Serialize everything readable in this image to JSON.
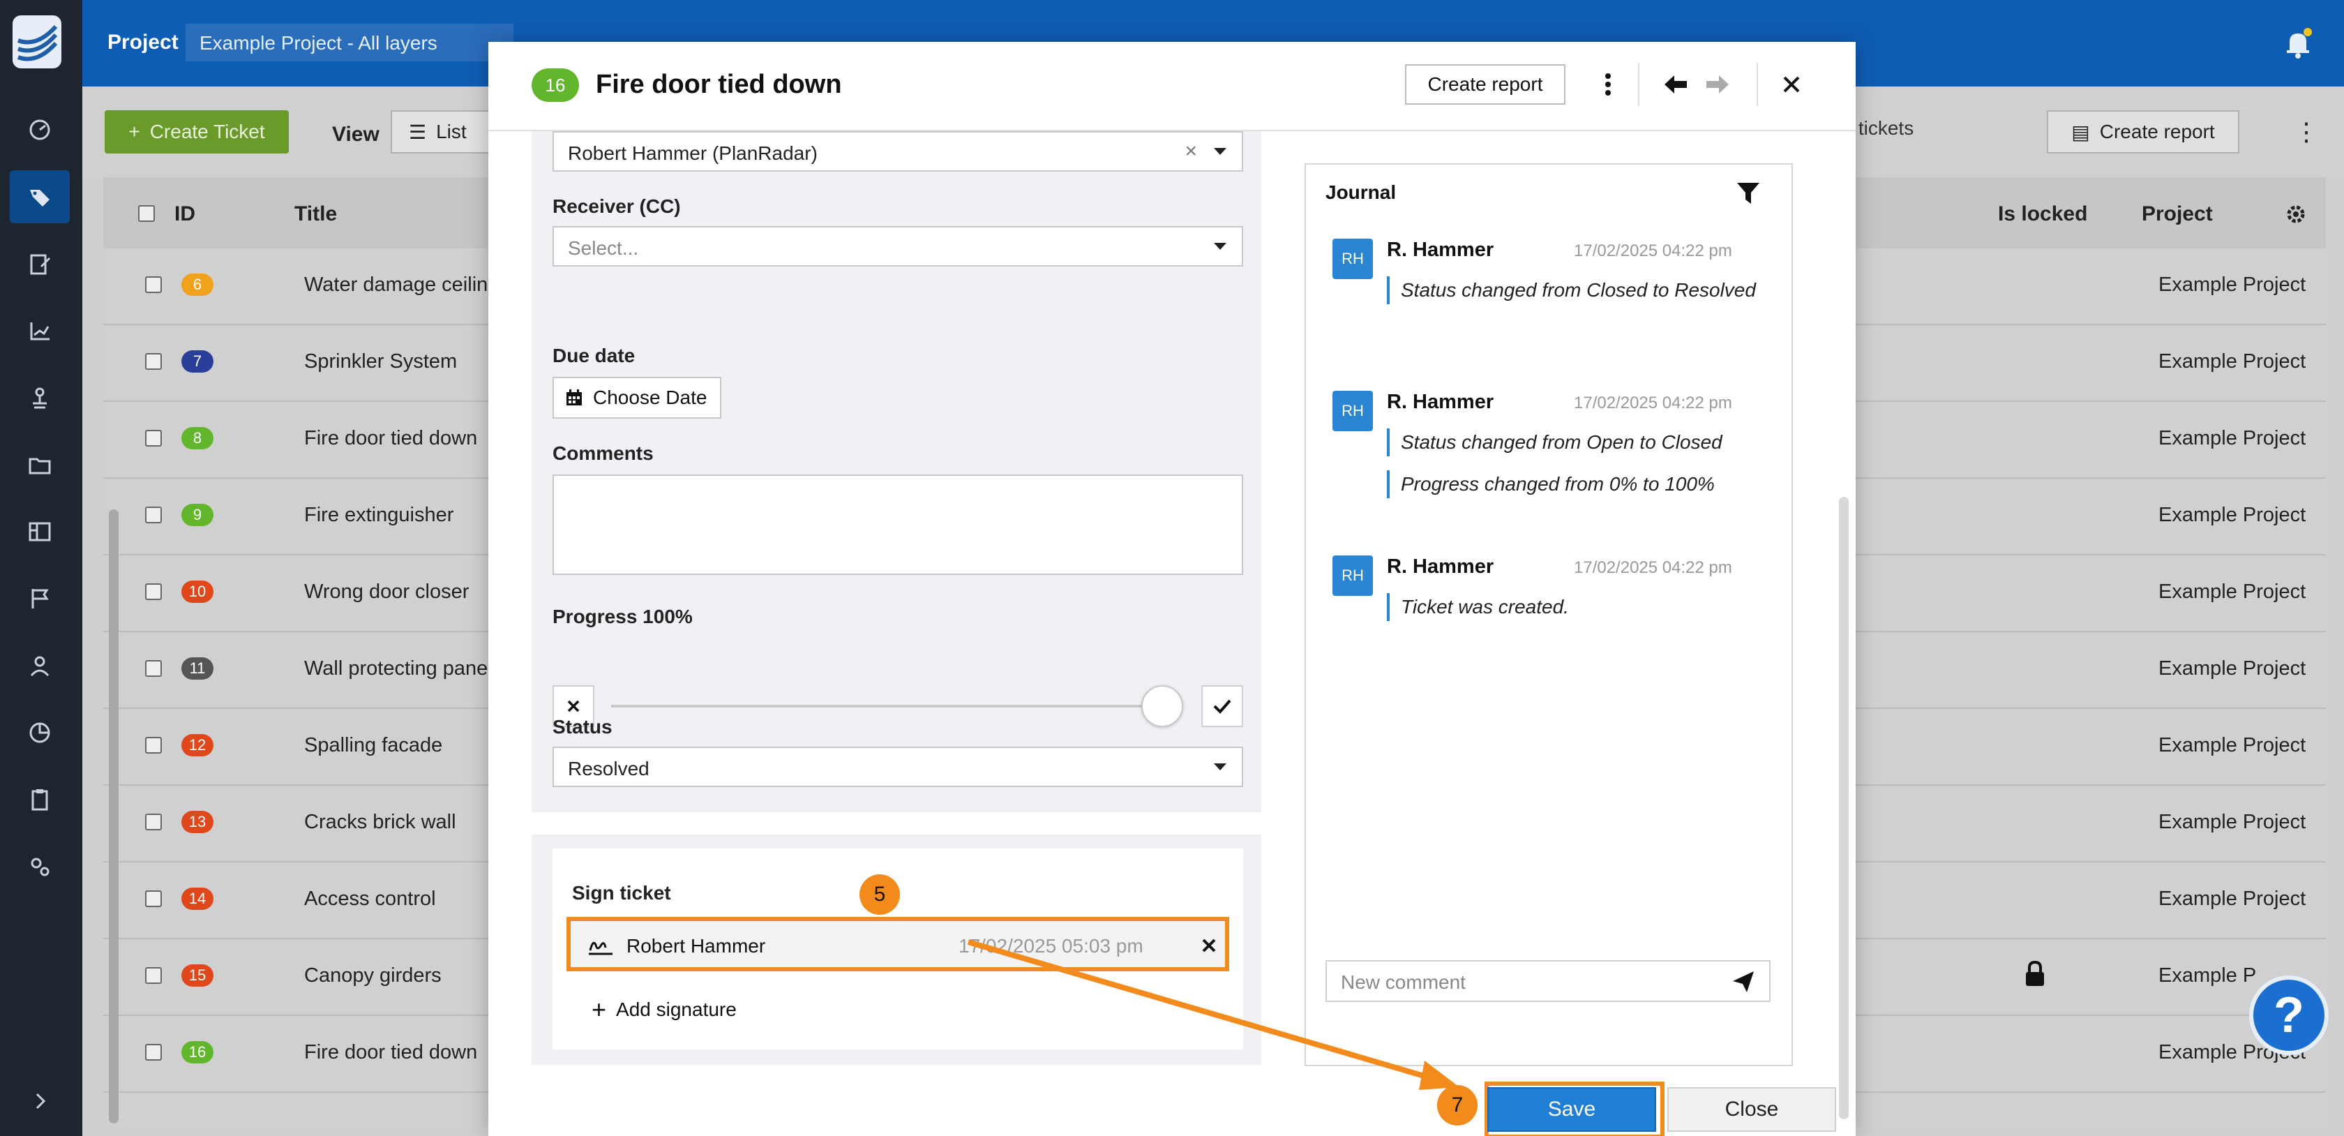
{
  "topbar": {
    "project_label": "Project",
    "project_value": "Example Project - All layers"
  },
  "toolbar": {
    "create_ticket": "Create Ticket",
    "view_label": "View",
    "list_label": "List",
    "hide_closed": "ide closed tickets",
    "create_report": "Create report"
  },
  "table": {
    "headers": {
      "id": "ID",
      "title": "Title",
      "is_locked": "Is locked",
      "project": "Project"
    },
    "rows": [
      {
        "id": "6",
        "title": "Water damage ceiling",
        "project": "Example Project",
        "color": "#f0a21c",
        "locked": false
      },
      {
        "id": "7",
        "title": "Sprinkler System",
        "project": "Example Project",
        "color": "#2a3f9a",
        "locked": false
      },
      {
        "id": "8",
        "title": "Fire door tied down",
        "project": "Example Project",
        "color": "#62b62c",
        "locked": false
      },
      {
        "id": "9",
        "title": "Fire extinguisher",
        "project": "Example Project",
        "color": "#62b62c",
        "locked": false
      },
      {
        "id": "10",
        "title": "Wrong door closer",
        "project": "Example Project",
        "color": "#e0481c",
        "locked": false
      },
      {
        "id": "11",
        "title": "Wall protecting panel",
        "project": "Example Project",
        "color": "#555555",
        "locked": false
      },
      {
        "id": "12",
        "title": "Spalling facade",
        "project": "Example Project",
        "color": "#e0481c",
        "locked": false
      },
      {
        "id": "13",
        "title": "Cracks brick wall",
        "project": "Example Project",
        "color": "#e0481c",
        "locked": false
      },
      {
        "id": "14",
        "title": "Access control",
        "project": "Example Project",
        "color": "#e0481c",
        "locked": false
      },
      {
        "id": "15",
        "title": "Canopy girders",
        "project": "Example P",
        "color": "#e0481c",
        "locked": true
      },
      {
        "id": "16",
        "title": "Fire door tied down",
        "project": "Example Project",
        "color": "#62b62c",
        "locked": false
      }
    ]
  },
  "modal": {
    "badge": "16",
    "title": "Fire door tied down",
    "create_report": "Create report",
    "assignee_value": "Robert Hammer (PlanRadar)",
    "receiver_label": "Receiver (CC)",
    "receiver_placeholder": "Select...",
    "due_date_label": "Due date",
    "choose_date": "Choose Date",
    "comments_label": "Comments",
    "progress_label": "Progress 100%",
    "progress_value": 1.0,
    "status_label": "Status",
    "status_value": "Resolved",
    "sign_ticket_label": "Sign ticket",
    "signature_name": "Robert Hammer",
    "signature_date": "17/02/2025 05:03 pm",
    "add_signature": "Add signature",
    "save": "Save",
    "close": "Close"
  },
  "journal": {
    "title": "Journal",
    "entries": [
      {
        "initials": "RH",
        "name": "R. Hammer",
        "time": "17/02/2025 04:22 pm",
        "lines": [
          "Status changed from Closed to Resolved"
        ]
      },
      {
        "initials": "RH",
        "name": "R. Hammer",
        "time": "17/02/2025 04:22 pm",
        "lines": [
          "Status changed from Open to Closed",
          "Progress changed from 0% to 100%"
        ]
      },
      {
        "initials": "RH",
        "name": "R. Hammer",
        "time": "17/02/2025 04:22 pm",
        "lines": [
          "Ticket was created."
        ]
      }
    ],
    "comment_placeholder": "New comment"
  },
  "callouts": {
    "step5": "5",
    "step7": "7"
  },
  "help": "?",
  "colors": {
    "primary": "#1f7fd4",
    "accent_orange": "#f28a1c",
    "badge_green": "#62b62c",
    "topbar_blue": "#0e5db5",
    "sidebar": "#1f2530"
  }
}
